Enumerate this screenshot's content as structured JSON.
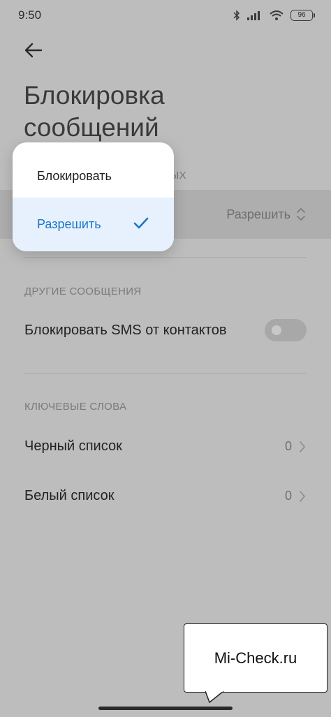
{
  "status_bar": {
    "time": "9:50",
    "battery": "96"
  },
  "page": {
    "title": "Блокировка сообщений"
  },
  "sections": {
    "first_label_partial": "ЫХ",
    "other_messages_label": "ДРУГИЕ СООБЩЕНИЯ",
    "keywords_label": "КЛЮЧЕВЫЕ СЛОВА"
  },
  "selected_row": {
    "value": "Разрешить"
  },
  "settings": {
    "block_sms_contacts": {
      "label": "Блокировать SMS от контактов",
      "enabled": false
    },
    "blacklist": {
      "label": "Черный список",
      "count": "0"
    },
    "whitelist": {
      "label": "Белый список",
      "count": "0"
    }
  },
  "popup": {
    "options": [
      {
        "label": "Блокировать",
        "selected": false
      },
      {
        "label": "Разрешить",
        "selected": true
      }
    ]
  },
  "watermark": {
    "text": "Mi-Check.ru"
  },
  "colors": {
    "accent": "#1c76c8",
    "popup_selected_bg": "#e6f1fd",
    "scrim": "#bdbdbd"
  }
}
